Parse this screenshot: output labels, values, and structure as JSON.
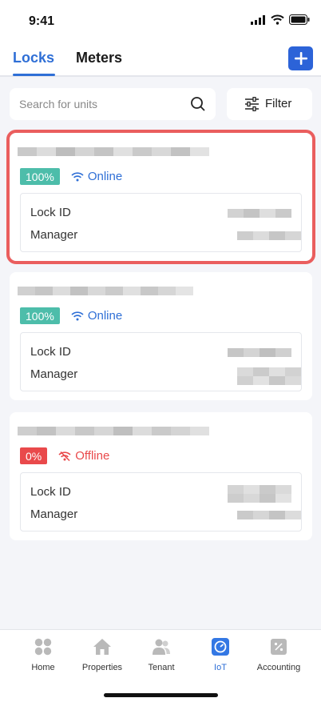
{
  "status_bar": {
    "time": "9:41"
  },
  "header": {
    "tabs": [
      {
        "label": "Locks",
        "active": true
      },
      {
        "label": "Meters",
        "active": false
      }
    ],
    "add_icon": "plus-icon"
  },
  "search": {
    "placeholder": "Search for units",
    "icon": "search-icon"
  },
  "filter": {
    "label": "Filter",
    "icon": "sliders-icon"
  },
  "locks": [
    {
      "battery": "100%",
      "status": "Online",
      "lock_id_label": "Lock ID",
      "manager_label": "Manager",
      "highlighted": true
    },
    {
      "battery": "100%",
      "status": "Online",
      "lock_id_label": "Lock ID",
      "manager_label": "Manager",
      "highlighted": false
    },
    {
      "battery": "0%",
      "status": "Offline",
      "lock_id_label": "Lock ID",
      "manager_label": "Manager",
      "highlighted": false
    }
  ],
  "colors": {
    "accent": "#2f6fd6",
    "online_badge": "#4dbdaa",
    "offline_badge": "#e9494b",
    "highlight": "#ea5e5e"
  },
  "bottom_nav": [
    {
      "label": "Home",
      "icon": "home-grid-icon"
    },
    {
      "label": "Properties",
      "icon": "house-icon"
    },
    {
      "label": "Tenant",
      "icon": "users-icon"
    },
    {
      "label": "IoT",
      "icon": "iot-gauge-icon",
      "active": true
    },
    {
      "label": "Accounting",
      "icon": "accounting-icon"
    }
  ]
}
